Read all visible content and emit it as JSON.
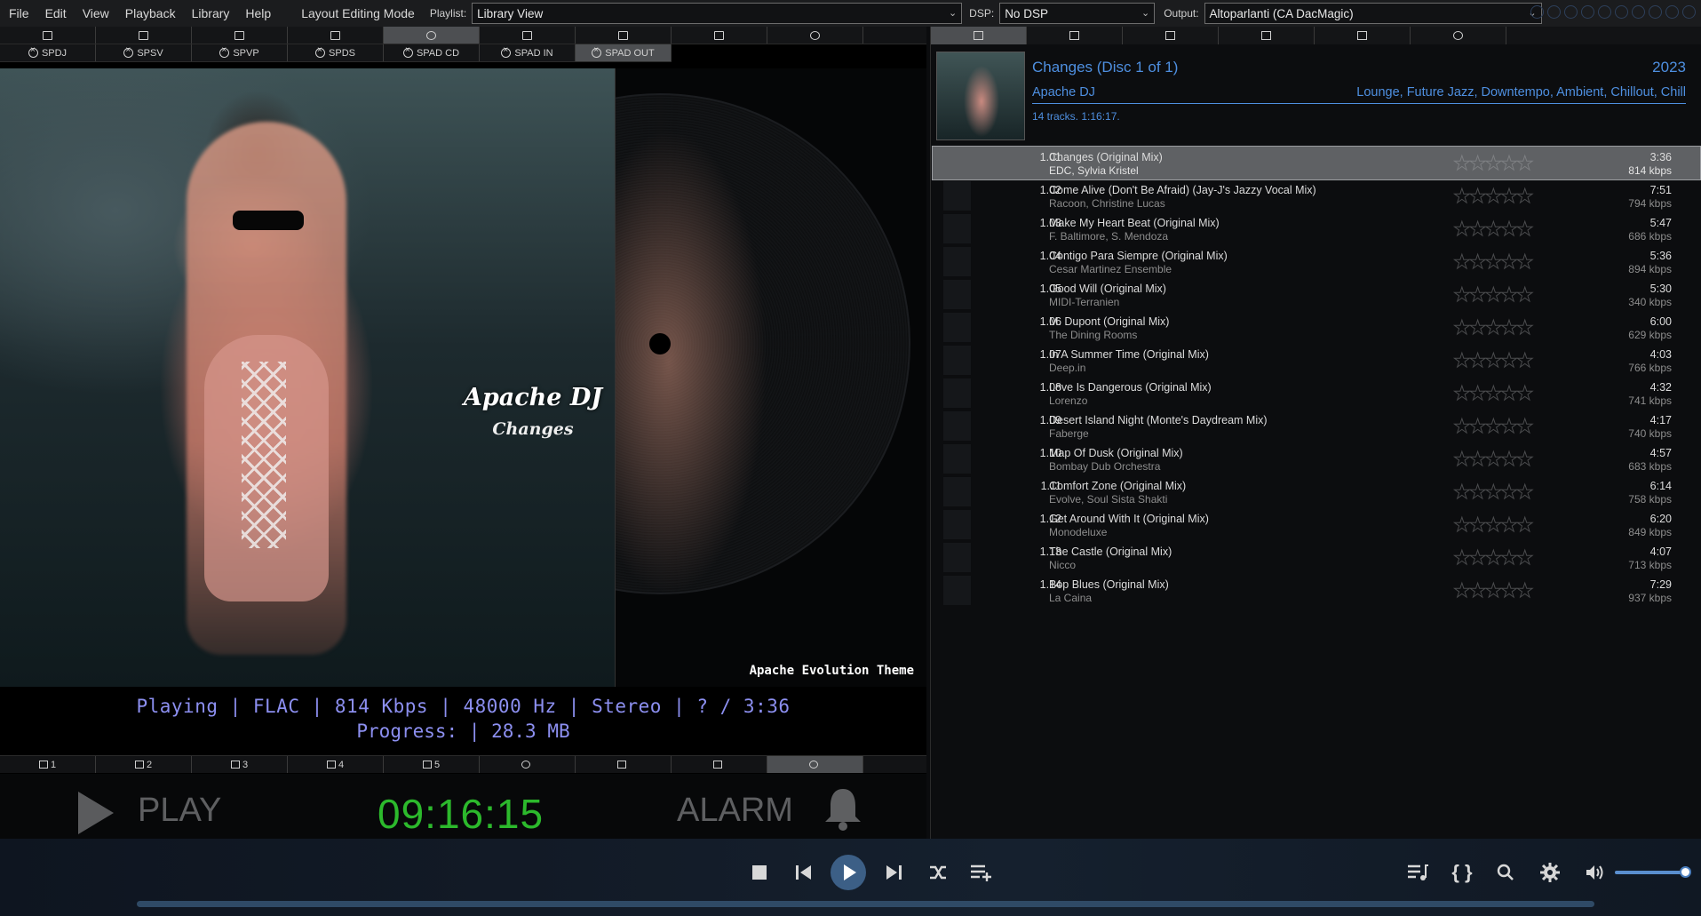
{
  "menu": {
    "items": [
      "File",
      "Edit",
      "View",
      "Playback",
      "Library",
      "Help"
    ],
    "layout_mode": "Layout Editing Mode",
    "playlist_label": "Playlist:",
    "playlist_value": "Library View",
    "dsp_label": "DSP:",
    "dsp_value": "No DSP",
    "output_label": "Output:",
    "output_value": "Altoparlanti (CA DacMagic)"
  },
  "left_tabs": [
    "SPDJ",
    "SPSV",
    "SPVP",
    "SPDS",
    "SPAD CD",
    "SPAD IN",
    "SPAD OUT"
  ],
  "art": {
    "artist_text": "Apache DJ",
    "title_text": "Changes",
    "theme_label": "Apache Evolution Theme"
  },
  "now_playing": {
    "line1": "Playing | FLAC | 814 Kbps | 48000 Hz | Stereo | ? / 3:36",
    "line2": "Progress:   | 28.3 MB"
  },
  "bottom_tabs": [
    "1",
    "2",
    "3",
    "4",
    "5"
  ],
  "clock_bar": {
    "play_label": "PLAY",
    "time": "09:16:15",
    "alarm_label": "ALARM"
  },
  "album": {
    "title": "Changes (Disc 1 of 1)",
    "year": "2023",
    "artist": "Apache DJ",
    "genres": "Lounge, Future Jazz, Downtempo, Ambient, Chillout, Chill",
    "summary": "14 tracks. 1:16:17."
  },
  "tracks": [
    {
      "num": "1.01",
      "title": "Changes (Original Mix)",
      "artist": "EDC, Sylvia Kristel",
      "duration": "3:36",
      "kbps": "814 kbps",
      "selected": true
    },
    {
      "num": "1.02",
      "title": "Come Alive (Don't Be Afraid) (Jay-J's Jazzy Vocal Mix)",
      "artist": "Racoon, Christine Lucas",
      "duration": "7:51",
      "kbps": "794 kbps"
    },
    {
      "num": "1.03",
      "title": "Make My Heart Beat (Original Mix)",
      "artist": "F. Baltimore, S. Mendoza",
      "duration": "5:47",
      "kbps": "686 kbps"
    },
    {
      "num": "1.04",
      "title": "Contigo Para Siempre (Original Mix)",
      "artist": "Cesar Martinez Ensemble",
      "duration": "5:36",
      "kbps": "894 kbps"
    },
    {
      "num": "1.05",
      "title": "Good Will (Original Mix)",
      "artist": "MIDI-Terranien",
      "duration": "5:30",
      "kbps": "340 kbps"
    },
    {
      "num": "1.06",
      "title": "M. Dupont (Original Mix)",
      "artist": "The Dining Rooms",
      "duration": "6:00",
      "kbps": "629 kbps"
    },
    {
      "num": "1.07",
      "title": "In A Summer Time (Original Mix)",
      "artist": "Deep.in",
      "duration": "4:03",
      "kbps": "766 kbps"
    },
    {
      "num": "1.08",
      "title": "Love Is Dangerous (Original Mix)",
      "artist": "Lorenzo",
      "duration": "4:32",
      "kbps": "741 kbps"
    },
    {
      "num": "1.09",
      "title": "Desert Island Night (Monte's Daydream Mix)",
      "artist": "Faberge",
      "duration": "4:17",
      "kbps": "740 kbps"
    },
    {
      "num": "1.10",
      "title": "Map Of Dusk (Original Mix)",
      "artist": "Bombay Dub Orchestra",
      "duration": "4:57",
      "kbps": "683 kbps"
    },
    {
      "num": "1.11",
      "title": "Comfort Zone (Original Mix)",
      "artist": "Evolve, Soul Sista Shakti",
      "duration": "6:14",
      "kbps": "758 kbps"
    },
    {
      "num": "1.12",
      "title": "Get Around With It (Original Mix)",
      "artist": "Monodeluxe",
      "duration": "6:20",
      "kbps": "849 kbps"
    },
    {
      "num": "1.13",
      "title": "The Castle (Original Mix)",
      "artist": "Nicco",
      "duration": "4:07",
      "kbps": "713 kbps"
    },
    {
      "num": "1.14",
      "title": "Bop Blues (Original Mix)",
      "artist": "La Caina",
      "duration": "7:29",
      "kbps": "937 kbps"
    }
  ],
  "transport": {
    "icons": [
      "stop-icon",
      "previous-icon",
      "play-icon",
      "next-icon",
      "shuffle-icon",
      "add-to-queue-icon",
      "queue-icon",
      "braces-icon",
      "search-icon",
      "settings-icon",
      "volume-icon"
    ],
    "volume": 1.0
  },
  "colors": {
    "accent_blue": "#4e8fe0",
    "clock_green": "#2cb92c",
    "now_playing_purple": "#8c8ff0"
  }
}
